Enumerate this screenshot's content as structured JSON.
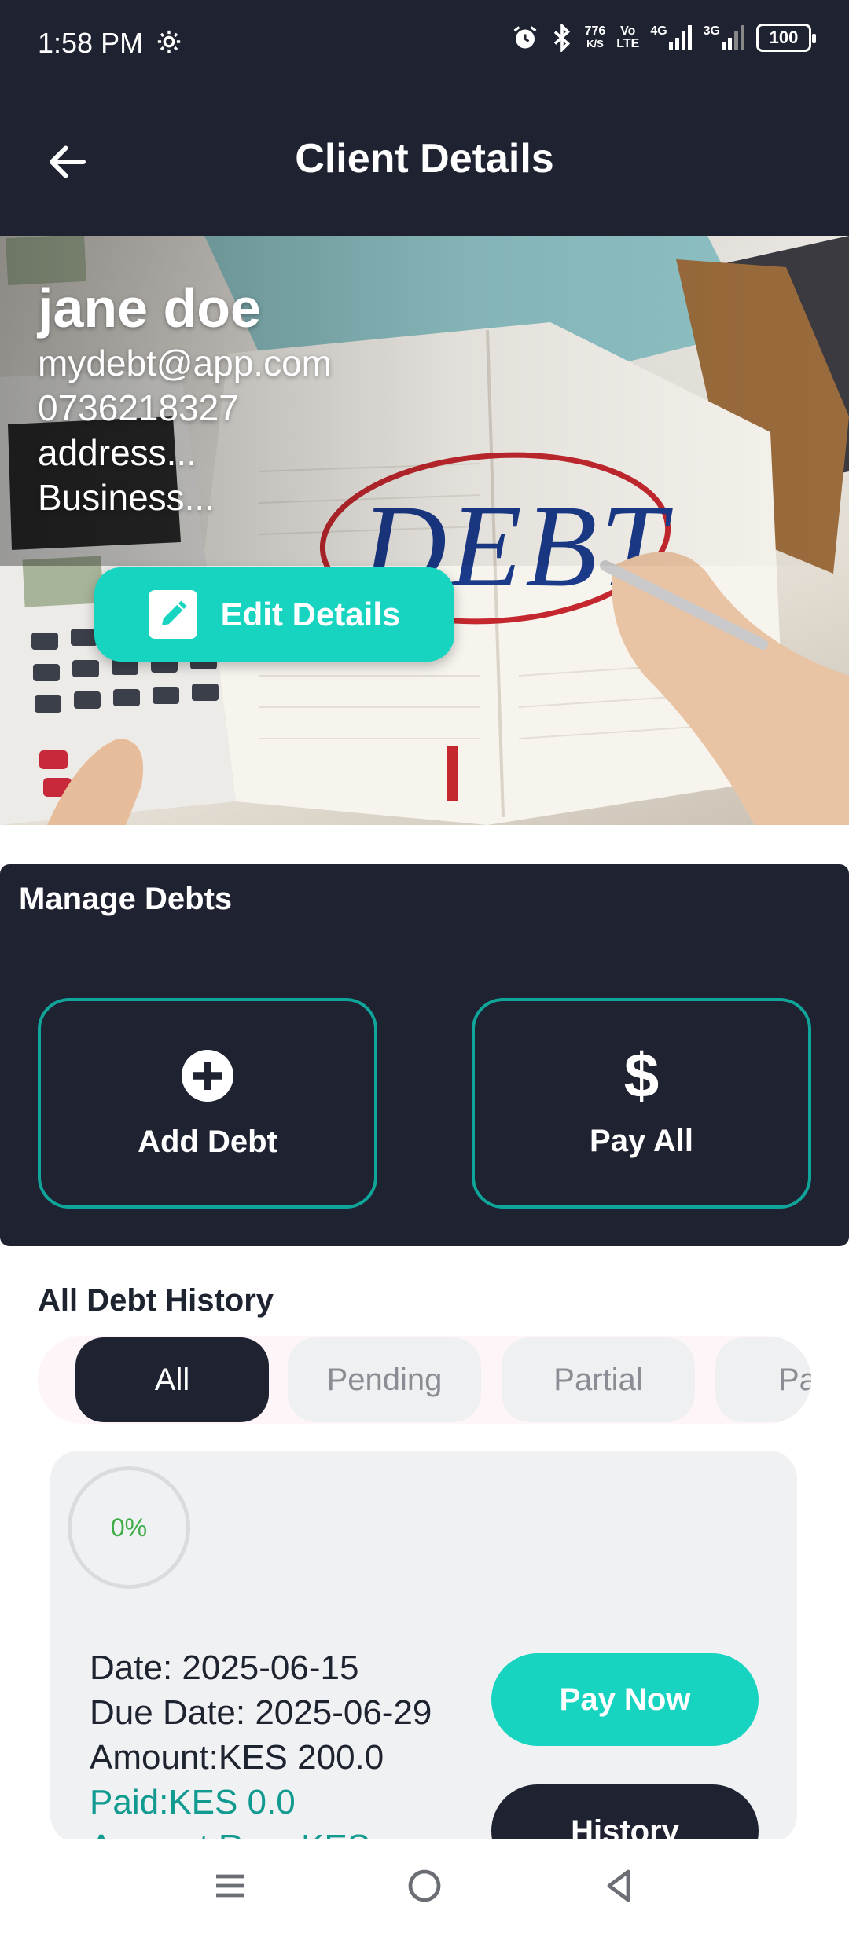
{
  "status_bar": {
    "time": "1:58 PM",
    "net_speed_value": "776",
    "net_speed_unit": "K/S",
    "volte_top": "Vo",
    "volte_bottom": "LTE",
    "sim1": "4G",
    "sim2": "3G",
    "battery": "100",
    "icons": [
      "gear-icon",
      "alarm-icon",
      "bluetooth-icon",
      "signal-icon",
      "battery-icon"
    ]
  },
  "app_bar": {
    "title": "Client Details",
    "back_icon": "arrow-left-icon"
  },
  "client": {
    "name": "jane doe",
    "email": "mydebt@app.com",
    "phone": "0736218327",
    "address": "address...",
    "business": "Business...",
    "edit_label": "Edit Details",
    "hero_image_text": "DEBT"
  },
  "manage": {
    "title": "Manage Debts",
    "add_label": "Add Debt",
    "pay_all_label": "Pay All",
    "pay_all_symbol": "$"
  },
  "history": {
    "title": "All Debt History",
    "filters": [
      "All",
      "Pending",
      "Partial",
      "Pa"
    ],
    "active_filter": "All"
  },
  "debt_card": {
    "progress": "0%",
    "date": "Date: 2025-06-15",
    "due_date": "Due Date: 2025-06-29",
    "amount": "Amount:KES 200.0",
    "paid": "Paid:KES 0.0",
    "remaining": "Amount Rem:KES",
    "pay_now_label": "Pay Now",
    "history_label": "History"
  },
  "colors": {
    "navy": "#1f2331",
    "teal": "#16d4c0",
    "teal_border": "#0fa59a",
    "paid_text": "#119a8f",
    "progress_text": "#3fae49"
  }
}
